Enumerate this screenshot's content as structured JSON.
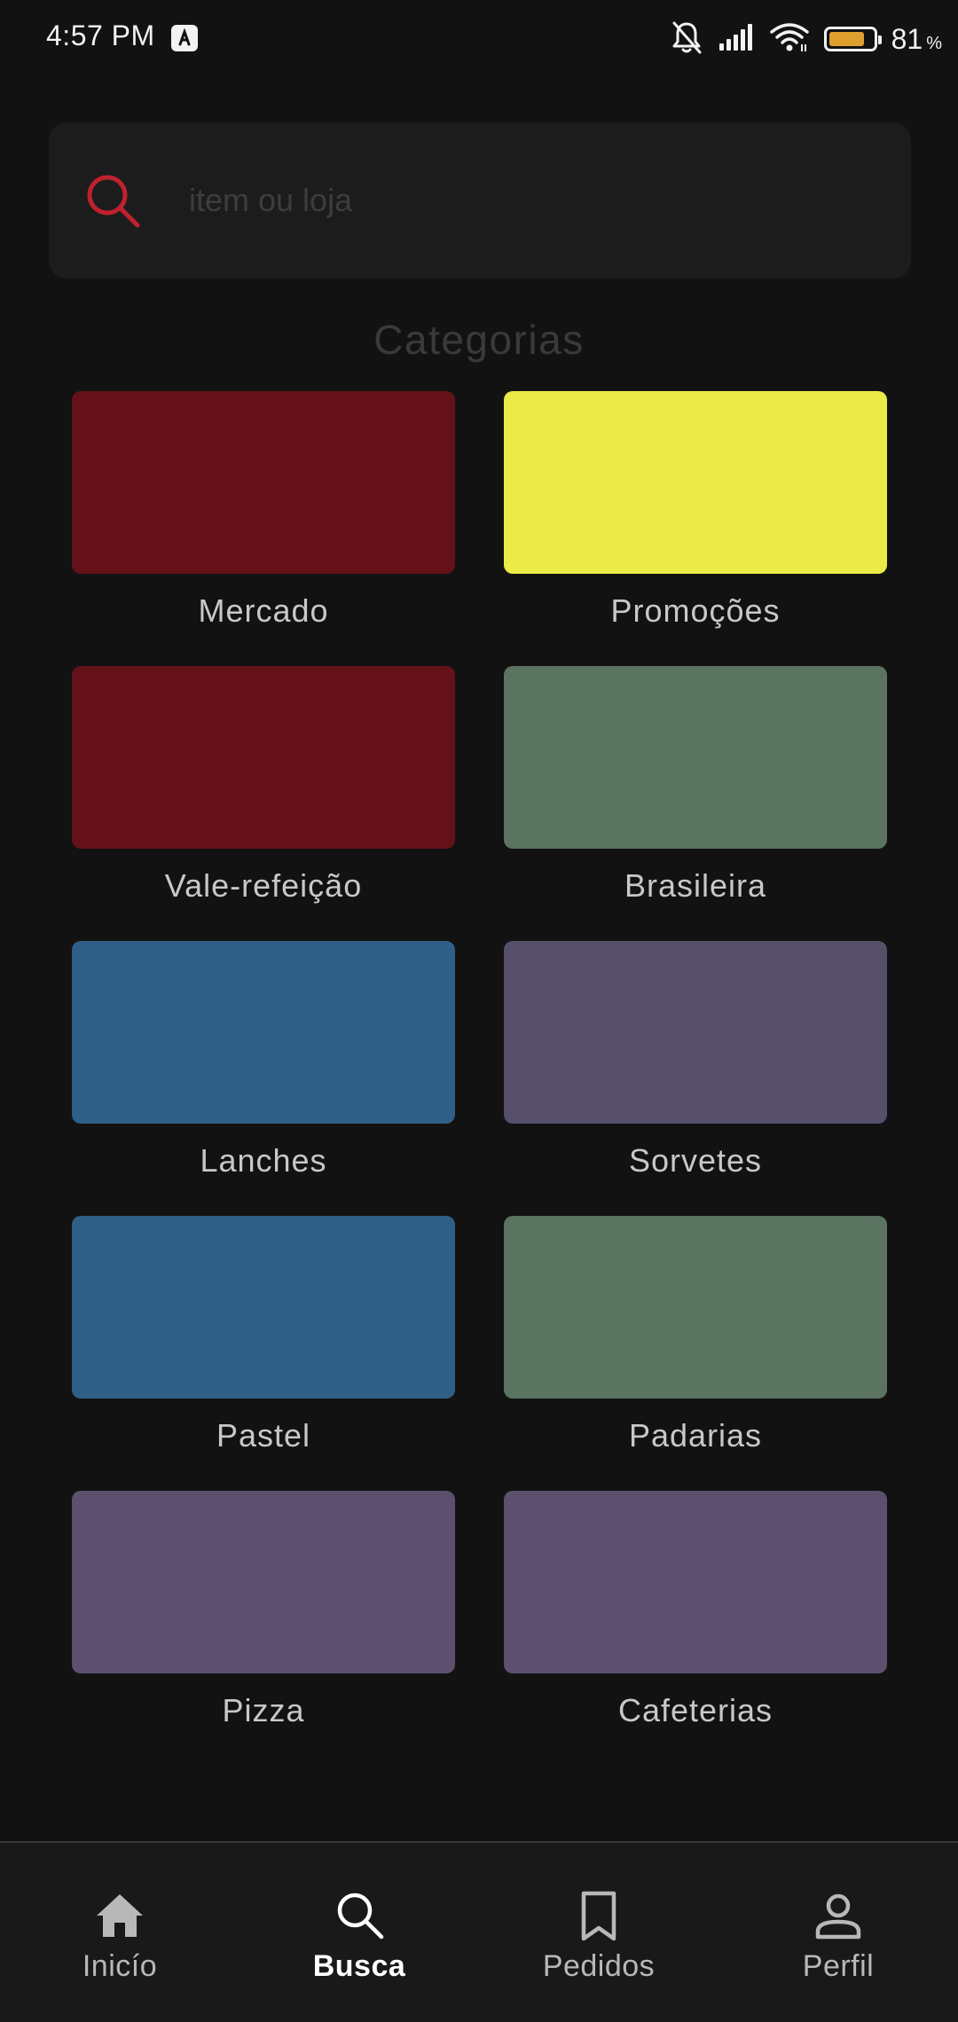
{
  "status_bar": {
    "time": "4:57 PM",
    "battery_level": "81",
    "battery_unit": "%",
    "battery_fraction": 0.81,
    "battery_color": "#e0a030",
    "icons": [
      "app-notification-icon",
      "bell-muted-icon",
      "signal-icon",
      "wifi-icon",
      "battery-icon"
    ]
  },
  "search": {
    "placeholder": "item ou loja",
    "value": "",
    "icon": "search-icon",
    "icon_color": "#c0212e"
  },
  "section": {
    "title": "Categorias"
  },
  "categories": [
    {
      "label": "Mercado",
      "color": "#64111a"
    },
    {
      "label": "Promoções",
      "color": "#ebeb48"
    },
    {
      "label": "Vale-refeição",
      "color": "#64111a"
    },
    {
      "label": "Brasileira",
      "color": "#5b7361"
    },
    {
      "label": "Lanches",
      "color": "#2f5f86"
    },
    {
      "label": "Sorvetes",
      "color": "#574f6a"
    },
    {
      "label": "Pastel",
      "color": "#2f5f86"
    },
    {
      "label": "Padarias",
      "color": "#5b7361"
    },
    {
      "label": "Pizza",
      "color": "#5c506e"
    },
    {
      "label": "Cafeterias",
      "color": "#5c506e"
    }
  ],
  "bottom_nav": {
    "active": "Busca",
    "items": [
      {
        "label": "Inicío",
        "icon": "home-icon"
      },
      {
        "label": "Busca",
        "icon": "search-icon"
      },
      {
        "label": "Pedidos",
        "icon": "bookmark-icon"
      },
      {
        "label": "Perfil",
        "icon": "person-icon"
      }
    ]
  }
}
